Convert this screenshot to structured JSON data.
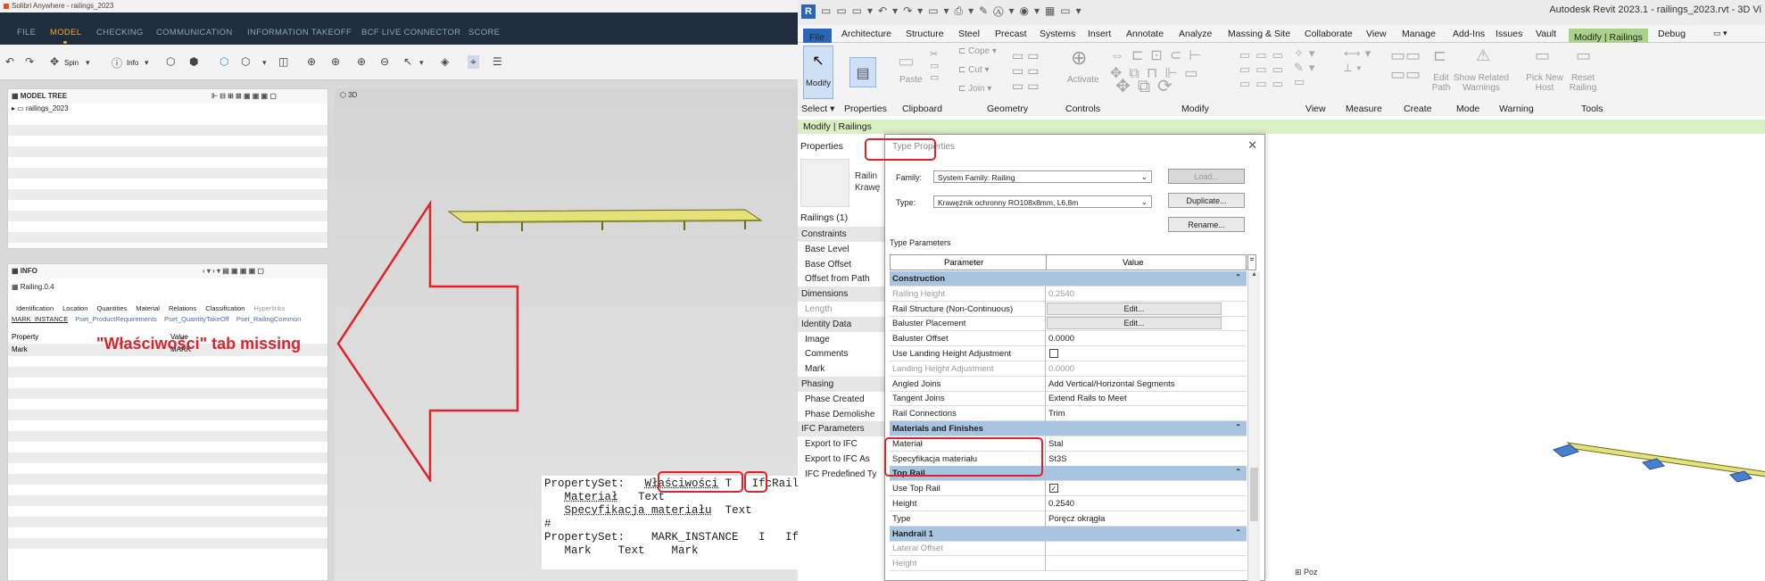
{
  "solibri": {
    "window_title": "Solibri Anywhere - railings_2023",
    "menu": [
      "FILE",
      "MODEL",
      "CHECKING",
      "COMMUNICATION",
      "INFORMATION TAKEOFF",
      "BCF LIVE CONNECTOR",
      "SCORE"
    ],
    "toolbar": {
      "spin_label": "Spin",
      "info_label": "Info"
    },
    "model_tree": {
      "title": "MODEL TREE",
      "root_item": "railings_2023"
    },
    "info_panel": {
      "title": "INFO",
      "selected": "Railing.0.4",
      "tabs": [
        "Identification",
        "Location",
        "Quantities",
        "Material",
        "Relations",
        "Classification",
        "Hyperlinks"
      ],
      "psets": [
        "MARK_INSTANCE",
        "Pset_ProductRequirements",
        "Pset_QuantityTakeOff",
        "Pset_RailingCommon"
      ],
      "col_property": "Property",
      "col_value": "Value",
      "rows": [
        {
          "property": "Mark",
          "value": "MARK"
        }
      ]
    },
    "view3d_label": "3D",
    "callout_text": "\"Właściwości\" tab missing"
  },
  "pset_file": {
    "line1_a": "PropertySet:   ",
    "line1_name": "Właściwości",
    "line1_sp": " ",
    "line1_type": "T",
    "line1_b": "   IfcRailing",
    "line2_name": "Materiał",
    "line2_type": "Text",
    "line3_name": "Specyfikacja materiału",
    "line3_type": "Text",
    "line4": "#",
    "line5": "PropertySet:    MARK_INSTANCE   I   IfcRailing",
    "line6": "   Mark    Text    Mark"
  },
  "revit": {
    "window_title": "Autodesk Revit 2023.1 - railings_2023.rvt - 3D Vi",
    "tabs": [
      "Architecture",
      "Structure",
      "Steel",
      "Precast",
      "Systems",
      "Insert",
      "Annotate",
      "Analyze",
      "Massing & Site",
      "Collaborate",
      "View",
      "Manage",
      "Add-Ins",
      "Issues",
      "Vault"
    ],
    "file_tab": "File",
    "active_tab": "Modify | Railings",
    "debug_tab": "Debug",
    "ribbon_panels": [
      "Select ▾",
      "Properties",
      "Clipboard",
      "Geometry",
      "Controls",
      "Modify",
      "View",
      "Measure",
      "Create",
      "Mode",
      "Warning",
      "Tools"
    ],
    "ribbon_tools": {
      "modify": "Modify",
      "paste": "Paste",
      "cope": "Cope",
      "cut": "Cut",
      "join": "Join",
      "activate": "Activate",
      "edit_path": "Edit Path",
      "show_related": "Show Related Warnings",
      "pick_host": "Pick New Host",
      "reset_railing": "Reset Railing"
    },
    "context_bar": "Modify | Railings",
    "properties": {
      "title": "Properties",
      "type_line1": "Railin",
      "type_line2": "Krawę",
      "count": "Railings (1)",
      "rows": [
        {
          "label": "Constraints",
          "kind": "grp"
        },
        {
          "label": "Base Level",
          "kind": "it"
        },
        {
          "label": "Base Offset",
          "kind": "it"
        },
        {
          "label": "Offset from Path",
          "kind": "it"
        },
        {
          "label": "Dimensions",
          "kind": "grp"
        },
        {
          "label": "Length",
          "kind": "gray"
        },
        {
          "label": "Identity Data",
          "kind": "grp"
        },
        {
          "label": "Image",
          "kind": "it"
        },
        {
          "label": "Comments",
          "kind": "it"
        },
        {
          "label": "Mark",
          "kind": "it"
        },
        {
          "label": "Phasing",
          "kind": "grp"
        },
        {
          "label": "Phase Created",
          "kind": "it"
        },
        {
          "label": "Phase Demolishe",
          "kind": "it"
        },
        {
          "label": "IFC Parameters",
          "kind": "grp"
        },
        {
          "label": "Export to IFC",
          "kind": "it"
        },
        {
          "label": "Export to IFC As",
          "kind": "it"
        },
        {
          "label": "IFC Predefined Ty",
          "kind": "it"
        }
      ]
    },
    "type_properties": {
      "title": "Type Properties",
      "family_label": "Family:",
      "family_value": "System Family: Railing",
      "type_label": "Type:",
      "type_value": "Krawężnik ochronny RO108x8mm, L6,8m",
      "load_btn": "Load...",
      "duplicate_btn": "Duplicate...",
      "rename_btn": "Rename...",
      "type_params_label": "Type Parameters",
      "col_parameter": "Parameter",
      "col_value": "Value",
      "grid_rows": [
        {
          "p": "Construction",
          "v": "",
          "kind": "sec"
        },
        {
          "p": "Railing Height",
          "v": "0.2540",
          "kind": "gray"
        },
        {
          "p": "Rail Structure (Non-Continuous)",
          "v": "Edit...",
          "kind": "btn"
        },
        {
          "p": "Baluster Placement",
          "v": "Edit...",
          "kind": "btn"
        },
        {
          "p": "Baluster Offset",
          "v": "0.0000",
          "kind": "row"
        },
        {
          "p": "Use Landing Height Adjustment",
          "v": "",
          "kind": "chk"
        },
        {
          "p": "Landing Height Adjustment",
          "v": "0.0000",
          "kind": "gray"
        },
        {
          "p": "Angled Joins",
          "v": "Add Vertical/Horizontal Segments",
          "kind": "row"
        },
        {
          "p": "Tangent Joins",
          "v": "Extend Rails to Meet",
          "kind": "row"
        },
        {
          "p": "Rail Connections",
          "v": "Trim",
          "kind": "row"
        },
        {
          "p": "Materials and Finishes",
          "v": "",
          "kind": "sec"
        },
        {
          "p": "Materiał",
          "v": "Stal",
          "kind": "row"
        },
        {
          "p": "Specyfikacja materiału",
          "v": "St3S",
          "kind": "row"
        },
        {
          "p": "Top Rail",
          "v": "",
          "kind": "sec"
        },
        {
          "p": "Use Top Rail",
          "v": "✓",
          "kind": "chk"
        },
        {
          "p": "Height",
          "v": "0.2540",
          "kind": "row"
        },
        {
          "p": "Type",
          "v": "Poręcz okrągła",
          "kind": "row"
        },
        {
          "p": "Handrail 1",
          "v": "",
          "kind": "sec"
        },
        {
          "p": "Lateral Offset",
          "v": "",
          "kind": "gray"
        },
        {
          "p": "Height",
          "v": "",
          "kind": "gray"
        }
      ]
    },
    "browser_item": "Poz"
  }
}
